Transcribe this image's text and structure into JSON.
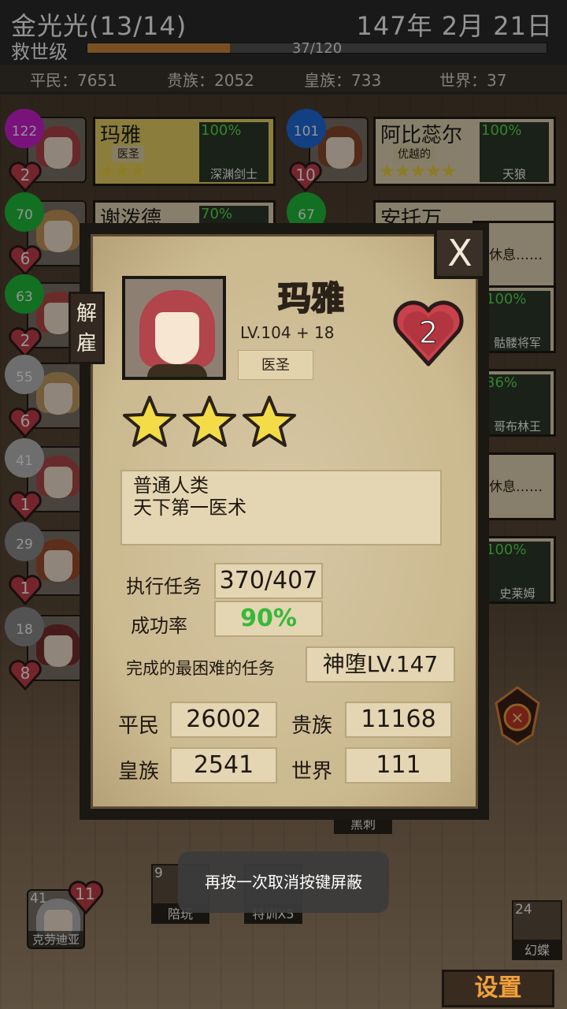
{
  "header": {
    "player": "金光光(13/14)",
    "date": "147年 2月 21日",
    "rank": "救世级",
    "xp_text": "37/120",
    "xp_fraction": 0.31
  },
  "populace": {
    "commoner": "平民：7651",
    "noble": "贵族：2052",
    "royal": "皇族：733",
    "world": "世界：37"
  },
  "roster": [
    {
      "level": "122",
      "heart": "2",
      "name": "玛雅",
      "class": "医圣",
      "stars": "★★★",
      "pct": "100%",
      "mission": "深渊剑士",
      "mission_count": "2",
      "badge_color": "#d21fd6",
      "hair": "#b2444b"
    },
    {
      "level": "101",
      "heart": "10",
      "name": "阿比蕊尔",
      "class": "优越的",
      "stars": "★★★★★",
      "pct": "100%",
      "mission": "天狼",
      "badge_color": "#1f6fe0",
      "hair": "#8a4a2c"
    },
    {
      "level": "70",
      "heart": "6",
      "name": "谢泼德",
      "pct": "70%",
      "badge_color": "#21c23b",
      "hair": "#c89a5a"
    },
    {
      "level": "67",
      "name": "安托万",
      "badge_color": "#21c23b",
      "hair": "#7d4b2c"
    },
    {
      "level": "63",
      "heart": "2",
      "badge_color": "#21c23b",
      "hair": "#b84b48"
    },
    {
      "level": "55",
      "heart": "6",
      "badge_color": "#bdbdbd",
      "hair": "#c9a066"
    },
    {
      "level": "41",
      "heart": "1",
      "badge_color": "#bdbdbd",
      "hair": "#b44a4a"
    },
    {
      "level": "29",
      "heart": "1",
      "badge_color": "#8f8f8f",
      "hair": "#a0502d"
    },
    {
      "level": "18",
      "heart": "8",
      "badge_color": "#8f8f8f",
      "hair": "#7b2f2f"
    }
  ],
  "right_column": [
    {
      "text": "休息……"
    },
    {
      "pct": "100%",
      "mission": "骷髅将军"
    },
    {
      "pct": "36%",
      "mission": "哥布林王"
    },
    {
      "text": "休息……"
    },
    {
      "pct": "100%",
      "mission": "史莱姆"
    }
  ],
  "detail": {
    "dismiss": "解雇",
    "close": "X",
    "name": "玛雅",
    "level": "LV.104 + 18",
    "class": "医圣",
    "hearts": "2",
    "stars": 3,
    "desc_line1": "普通人类",
    "desc_line2": "天下第一医术",
    "missions_label": "执行任务",
    "missions_value": "370/407",
    "success_label": "成功率",
    "success_value": "90%",
    "hardest_label": "完成的最困难的任务",
    "hardest_value": "神堕LV.147",
    "commoner_label": "平民",
    "commoner_value": "26002",
    "noble_label": "贵族",
    "noble_value": "11168",
    "royal_label": "皇族",
    "royal_value": "2541",
    "world_label": "世界",
    "world_value": "111"
  },
  "bottom": {
    "item_partial": "黑刺",
    "item1_num": "9",
    "item1_label": "陪玩",
    "item2_label": "特训X5",
    "item3_num": "24",
    "item3_label": "幻蝶",
    "hero_level": "41",
    "hero_heart": "11",
    "hero_name": "克劳迪亚",
    "toast": "再按一次取消按键屏蔽",
    "settings": "设置"
  },
  "colors": {
    "success_green": "#37b83a",
    "accent_orange": "#f2a23a",
    "heart_red": "#c8414b"
  }
}
